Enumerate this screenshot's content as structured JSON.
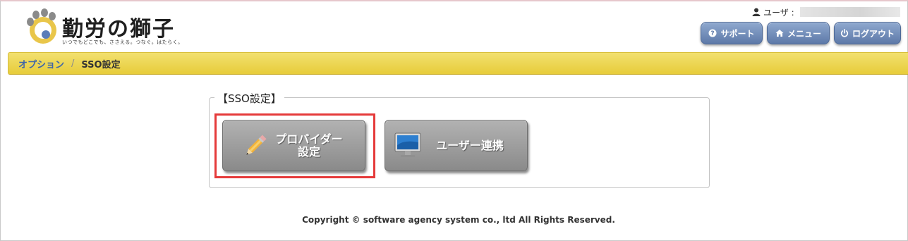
{
  "header": {
    "logo_title": "勤労の獅子",
    "logo_tagline": "いつでもどこでも、ささえる。つなぐ。はたらく。",
    "user_label": "ユーザ :",
    "buttons": {
      "support": "サポート",
      "menu": "メニュー",
      "logout": "ログアウト"
    }
  },
  "breadcrumb": {
    "parent": "オプション",
    "separator": "/",
    "current": "SSO設定"
  },
  "panel": {
    "legend": "【SSO設定】",
    "provider_button": {
      "line1": "プロバイダー",
      "line2": "設定"
    },
    "user_link_button": "ユーザー連携"
  },
  "footer": {
    "copyright": "Copyright © software agency system co., ltd All Rights Reserved."
  },
  "colors": {
    "breadcrumb_bg": "#ecd555",
    "header_button": "#6f8bb9",
    "big_button": "#9c9c9c",
    "highlight": "#e53a3a",
    "crumb_link": "#3f66a8"
  },
  "icons": [
    "user-icon",
    "help-icon",
    "home-icon",
    "power-icon",
    "pencil-icon",
    "monitor-icon"
  ]
}
